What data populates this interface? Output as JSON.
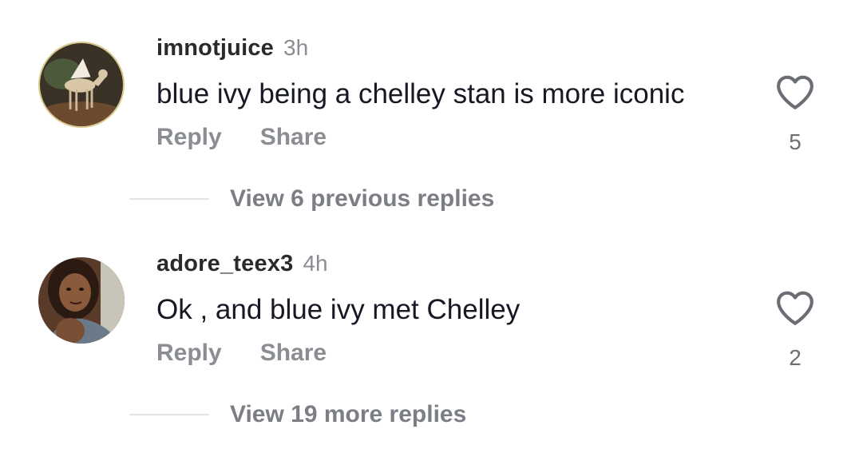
{
  "comments": [
    {
      "username": "imnotjuice",
      "time": "3h",
      "text": "blue ivy being a chelley stan is more iconic",
      "reply_label": "Reply",
      "share_label": "Share",
      "likes": "5",
      "like_icon": "heart-outline-icon",
      "view_replies": "View 6 previous replies"
    },
    {
      "username": "adore_teex3",
      "time": "4h",
      "text": "Ok , and blue ivy met Chelley",
      "reply_label": "Reply",
      "share_label": "Share",
      "likes": "2",
      "like_icon": "heart-outline-icon",
      "view_replies": "View 19 more replies"
    }
  ],
  "colors": {
    "text": "#161823",
    "muted": "#8a8d92",
    "divider": "#e3e3e5"
  }
}
